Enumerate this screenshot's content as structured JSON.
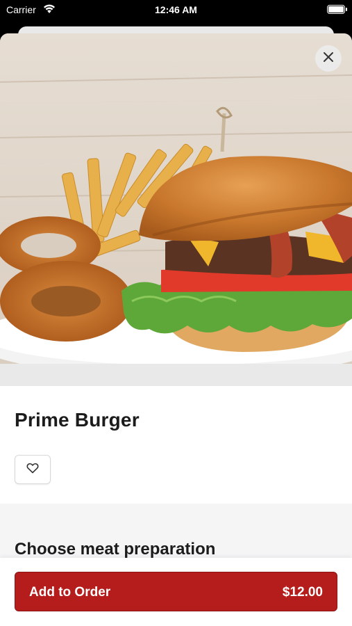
{
  "status_bar": {
    "carrier": "Carrier",
    "time": "12:46 AM",
    "wifi_icon": "wifi-icon",
    "battery_icon": "battery-icon"
  },
  "item": {
    "image_alt": "Burger with fries and onion rings",
    "title": "Prime Burger",
    "favorite_icon": "heart-icon"
  },
  "close_icon": "close-icon",
  "options": {
    "heading": "Choose meat preparation"
  },
  "footer": {
    "add_label": "Add to Order",
    "price": "$12.00"
  },
  "colors": {
    "accent": "#b51c1c",
    "sheet_background": "#ffffff",
    "section_background": "#f5f5f6"
  }
}
